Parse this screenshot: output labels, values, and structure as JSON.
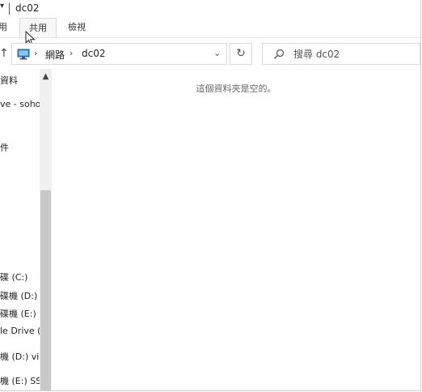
{
  "window": {
    "title": "dc02"
  },
  "ribbon": {
    "tabs": [
      "用",
      "共用",
      "檢視"
    ]
  },
  "address": {
    "crumbs": [
      "網路",
      "dc02"
    ],
    "separator": "›",
    "up_arrow": "↑",
    "chevron": "⌄",
    "refresh": "↻"
  },
  "search": {
    "placeholder": "搜尋 dc02"
  },
  "nav": {
    "items": [
      "資料",
      "ve - soho",
      "件",
      "碟 (C:)",
      "碟機 (D:) v",
      "碟機 (E:) S",
      "le Drive (G",
      "機 (D:) vir",
      "機 (E:) SS"
    ]
  },
  "content": {
    "empty_message": "這個資料夾是空的。"
  }
}
